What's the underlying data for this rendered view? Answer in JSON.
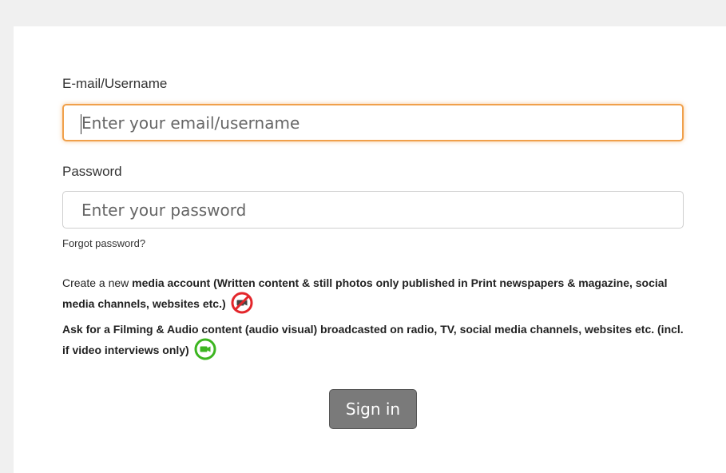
{
  "form": {
    "email_label": "E-mail/Username",
    "email_placeholder": "Enter your email/username",
    "email_value": "",
    "password_label": "Password",
    "password_placeholder": "Enter your password",
    "password_value": "",
    "forgot_link": "Forgot password?",
    "sign_in_label": "Sign in"
  },
  "info": {
    "media_prefix": "Create a new ",
    "media_link": "media account (Written content & still photos only published in Print newspapers & magazine, social media channels, websites etc.)",
    "media_icon": "no-camera-icon",
    "filming_link": "Ask for a Filming & Audio content (audio visual) broadcasted on radio, TV, social media channels, websites etc. (incl. if video interviews only)",
    "filming_icon": "camera-icon"
  },
  "colors": {
    "focus_border": "#f0a04b",
    "no_camera_red": "#e3262b",
    "camera_green": "#3cb520",
    "button_bg": "#7a7a7a"
  }
}
